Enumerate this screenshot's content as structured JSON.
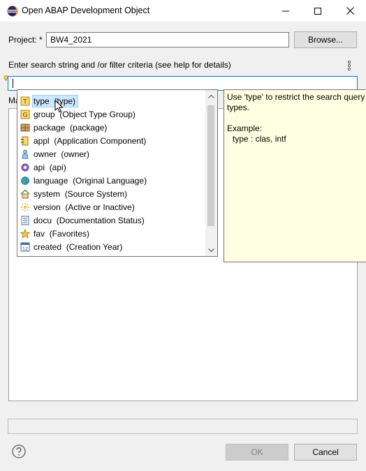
{
  "window": {
    "title": "Open ABAP Development Object"
  },
  "project": {
    "label": "Project: *",
    "value": "BW4_2021",
    "browse_label": "Browse..."
  },
  "search": {
    "label": "Enter search string and /or filter criteria (see help for details)",
    "value": "",
    "placeholder": ""
  },
  "matching_label": "Ma",
  "dropdown": {
    "items": [
      {
        "label": "type",
        "desc": "(type)",
        "icon": "type-icon",
        "selected": true
      },
      {
        "label": "group",
        "desc": "(Object Type Group)",
        "icon": "group-icon"
      },
      {
        "label": "package",
        "desc": "(package)",
        "icon": "package-icon"
      },
      {
        "label": "appl",
        "desc": "(Application Component)",
        "icon": "application-component-icon"
      },
      {
        "label": "owner",
        "desc": "(owner)",
        "icon": "owner-icon"
      },
      {
        "label": "api",
        "desc": "(api)",
        "icon": "api-gear-icon"
      },
      {
        "label": "language",
        "desc": "(Original Language)",
        "icon": "globe-icon"
      },
      {
        "label": "system",
        "desc": "(Source System)",
        "icon": "house-icon"
      },
      {
        "label": "version",
        "desc": "(Active or Inactive)",
        "icon": "version-icon"
      },
      {
        "label": "docu",
        "desc": "(Documentation Status)",
        "icon": "document-icon"
      },
      {
        "label": "fav",
        "desc": "(Favorites)",
        "icon": "star-icon"
      },
      {
        "label": "created",
        "desc": "(Creation Year)",
        "icon": "calendar-icon"
      }
    ]
  },
  "tooltip": {
    "line1": "Use 'type' to restrict the search query b",
    "line2": "types.",
    "example_label": "Example:",
    "example_value": "type : clas, intf"
  },
  "buttons": {
    "ok_label": "OK",
    "cancel_label": "Cancel"
  },
  "colors": {
    "selection": "#cce8ff",
    "focus_border": "#0078d7",
    "tooltip_bg": "#ffffe1"
  }
}
